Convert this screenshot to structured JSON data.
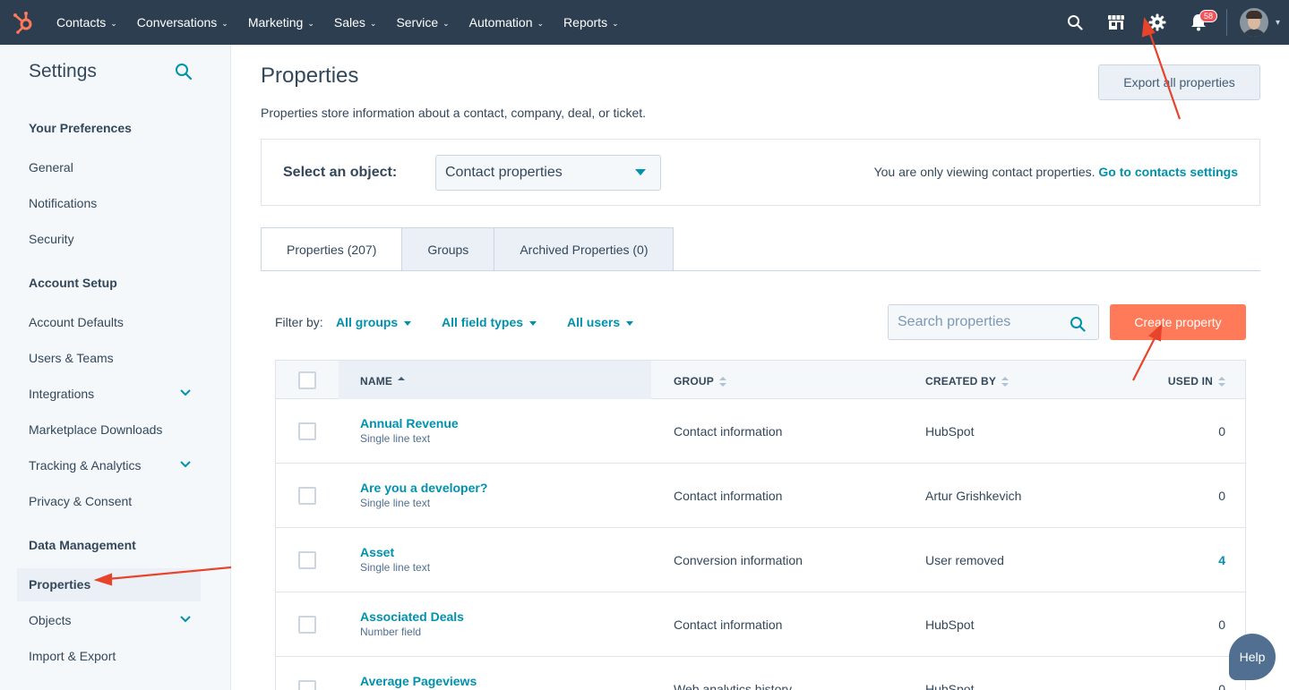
{
  "nav": {
    "items": [
      {
        "label": "Contacts"
      },
      {
        "label": "Conversations"
      },
      {
        "label": "Marketing"
      },
      {
        "label": "Sales"
      },
      {
        "label": "Service"
      },
      {
        "label": "Automation"
      },
      {
        "label": "Reports"
      }
    ],
    "notification_count": "58",
    "brand_color": "#ff7a59",
    "bar_color": "#2d3e50"
  },
  "sidebar": {
    "title": "Settings",
    "sections": [
      {
        "heading": "Your Preferences",
        "items": [
          "General",
          "Notifications",
          "Security"
        ]
      },
      {
        "heading": "Account Setup",
        "items": [
          "Account Defaults",
          "Users & Teams",
          "Integrations",
          "Marketplace Downloads",
          "Tracking & Analytics",
          "Privacy & Consent"
        ]
      },
      {
        "heading": "Data Management",
        "items": [
          "Properties",
          "Objects",
          "Import & Export"
        ]
      }
    ],
    "active_item": "Properties"
  },
  "main": {
    "title": "Properties",
    "description": "Properties store information about a contact, company, deal, or ticket.",
    "export_label": "Export all properties",
    "object_selector": {
      "label": "Select an object:",
      "value": "Contact properties",
      "note": "You are only viewing contact properties.",
      "note_link": "Go to contacts settings"
    },
    "tabs": [
      "Properties (207)",
      "Groups",
      "Archived Properties (0)"
    ],
    "active_tab": "Properties (207)",
    "filters": {
      "label": "Filter by:",
      "groups": "All groups",
      "field_types": "All field types",
      "users": "All users"
    },
    "search_placeholder": "Search properties",
    "create_label": "Create property"
  },
  "table": {
    "headers": {
      "name": "NAME",
      "group": "GROUP",
      "created_by": "CREATED BY",
      "used_in": "USED IN"
    },
    "rows": [
      {
        "name": "Annual Revenue",
        "type": "Single line text",
        "group": "Contact information",
        "created_by": "HubSpot",
        "used_in": "0"
      },
      {
        "name": "Are you a developer?",
        "type": "Single line text",
        "group": "Contact information",
        "created_by": "Artur Grishkevich",
        "used_in": "0"
      },
      {
        "name": "Asset",
        "type": "Single line text",
        "group": "Conversion information",
        "created_by": "User removed",
        "used_in": "4"
      },
      {
        "name": "Associated Deals",
        "type": "Number field",
        "group": "Contact information",
        "created_by": "HubSpot",
        "used_in": "0"
      },
      {
        "name": "Average Pageviews",
        "type": "",
        "group": "Web analytics history",
        "created_by": "HubSpot",
        "used_in": "0"
      }
    ]
  },
  "help_label": "Help",
  "colors": {
    "accent": "#0091ae",
    "cta": "#ff7a59",
    "annotation_arrow": "#e8432b"
  }
}
